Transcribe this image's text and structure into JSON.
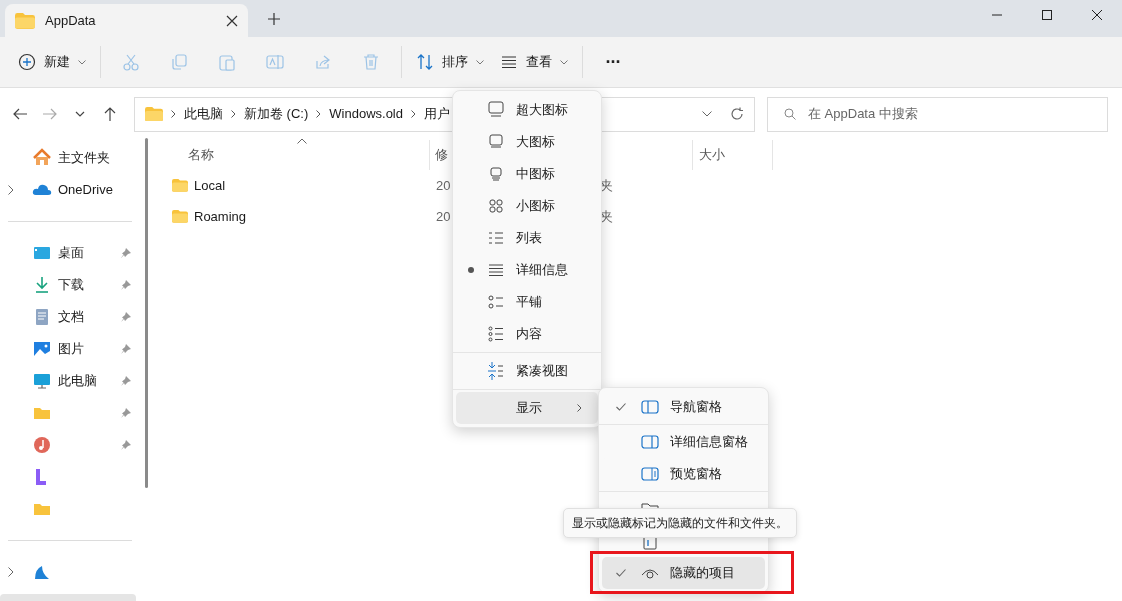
{
  "tab": {
    "title": "AppData"
  },
  "toolbar": [
    {
      "kind": "new",
      "label": "新建",
      "disabled": false
    },
    {
      "kind": "cut",
      "disabled": true
    },
    {
      "kind": "copy",
      "disabled": true
    },
    {
      "kind": "paste",
      "disabled": true
    },
    {
      "kind": "rename",
      "disabled": true
    },
    {
      "kind": "share",
      "disabled": true
    },
    {
      "kind": "delete",
      "disabled": true
    },
    {
      "kind": "sort",
      "label": "排序",
      "disabled": false
    },
    {
      "kind": "view",
      "label": "查看",
      "disabled": false
    },
    {
      "kind": "more",
      "label": "···",
      "disabled": false
    }
  ],
  "breadcrumb": [
    "此电脑",
    "新加卷 (C:)",
    "Windows.old",
    "用户"
  ],
  "search": {
    "placeholder": "在 AppData 中搜索"
  },
  "sidebar": [
    {
      "kind": "home",
      "label": "主文件夹",
      "expandable": false,
      "pinned": false
    },
    {
      "kind": "cloud",
      "label": "OneDrive",
      "expandable": true,
      "pinned": false
    },
    {
      "kind": "divider"
    },
    {
      "kind": "desktop",
      "label": "桌面",
      "expandable": false,
      "pinned": true
    },
    {
      "kind": "download",
      "label": "下载",
      "expandable": false,
      "pinned": true
    },
    {
      "kind": "document",
      "label": "文档",
      "expandable": false,
      "pinned": true
    },
    {
      "kind": "picture",
      "label": "图片",
      "expandable": false,
      "pinned": true
    },
    {
      "kind": "pc",
      "label": "此电脑",
      "expandable": false,
      "pinned": true
    },
    {
      "kind": "folder",
      "expandable": false,
      "pinned": true
    },
    {
      "kind": "music",
      "expandable": false,
      "pinned": true
    },
    {
      "kind": "video",
      "expandable": false,
      "pinned": false
    },
    {
      "kind": "folder",
      "expandable": false,
      "pinned": false
    },
    {
      "kind": "divider"
    },
    {
      "kind": "network",
      "expandable": true,
      "pinned": false
    }
  ],
  "columns": [
    "名称",
    "修",
    "大小"
  ],
  "files": [
    {
      "name": "Local",
      "date": "20",
      "type": "夹"
    },
    {
      "name": "Roaming",
      "date": "20",
      "type": "夹"
    }
  ],
  "view_menu": [
    {
      "kind": "xl",
      "label": "超大图标",
      "selected": false
    },
    {
      "kind": "lg",
      "label": "大图标",
      "selected": false
    },
    {
      "kind": "md",
      "label": "中图标",
      "selected": false
    },
    {
      "kind": "sm",
      "label": "小图标",
      "selected": false
    },
    {
      "kind": "list",
      "label": "列表",
      "selected": false
    },
    {
      "kind": "details",
      "label": "详细信息",
      "selected": true
    },
    {
      "kind": "tiles",
      "label": "平铺",
      "selected": false
    },
    {
      "kind": "content",
      "label": "内容",
      "selected": false
    },
    {
      "kind": "divider"
    },
    {
      "kind": "compact",
      "label": "紧凑视图",
      "selected": false
    },
    {
      "kind": "divider"
    },
    {
      "kind": "show",
      "label": "显示",
      "selected": false
    }
  ],
  "show_menu": [
    {
      "kind": "navpane",
      "label": "导航窗格",
      "checked": true,
      "hover": false
    },
    {
      "kind": "divider"
    },
    {
      "kind": "detailspane",
      "label": "详细信息窗格",
      "checked": false,
      "hover": false
    },
    {
      "kind": "previewpane",
      "label": "预览窗格",
      "checked": false,
      "hover": false
    },
    {
      "kind": "divider"
    },
    {
      "kind": "checkbox",
      "checked": false,
      "hover": false
    },
    {
      "kind": "ext",
      "checked": false,
      "hover": false
    },
    {
      "kind": "hidden",
      "label": "隐藏的项目",
      "checked": true,
      "hover": true
    }
  ],
  "tooltip": "显示或隐藏标记为隐藏的文件和文件夹。"
}
